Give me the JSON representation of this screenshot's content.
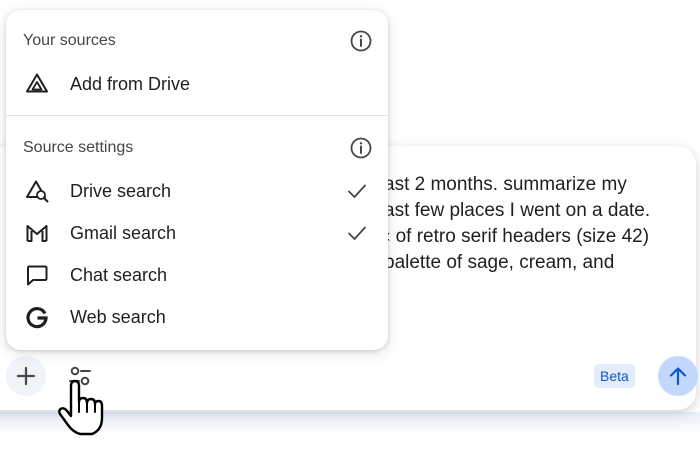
{
  "prompt": {
    "lines": [
      "ast 2 months. summarize my",
      "ast few places I went on a date.",
      "‹ of retro serif headers (size 42)",
      "palette of sage, cream, and"
    ]
  },
  "composer": {
    "beta_label": "Beta",
    "plus_icon": "plus-icon",
    "tools_icon": "tools-icon",
    "send_icon": "arrow-up-icon"
  },
  "menu": {
    "your_sources": {
      "title": "Your sources",
      "items": [
        {
          "label": "Add from Drive",
          "icon": "drive-icon"
        }
      ]
    },
    "source_settings": {
      "title": "Source settings",
      "items": [
        {
          "label": "Drive search",
          "icon": "drive-search-icon",
          "checked": true
        },
        {
          "label": "Gmail search",
          "icon": "gmail-icon",
          "checked": true
        },
        {
          "label": "Chat search",
          "icon": "chat-icon",
          "checked": false
        },
        {
          "label": "Web search",
          "icon": "google-icon",
          "checked": false
        }
      ]
    }
  },
  "colors": {
    "accent_blue": "#0b57d0",
    "send_button": "#c2d7fb",
    "badge_bg": "#e3ecfb"
  }
}
